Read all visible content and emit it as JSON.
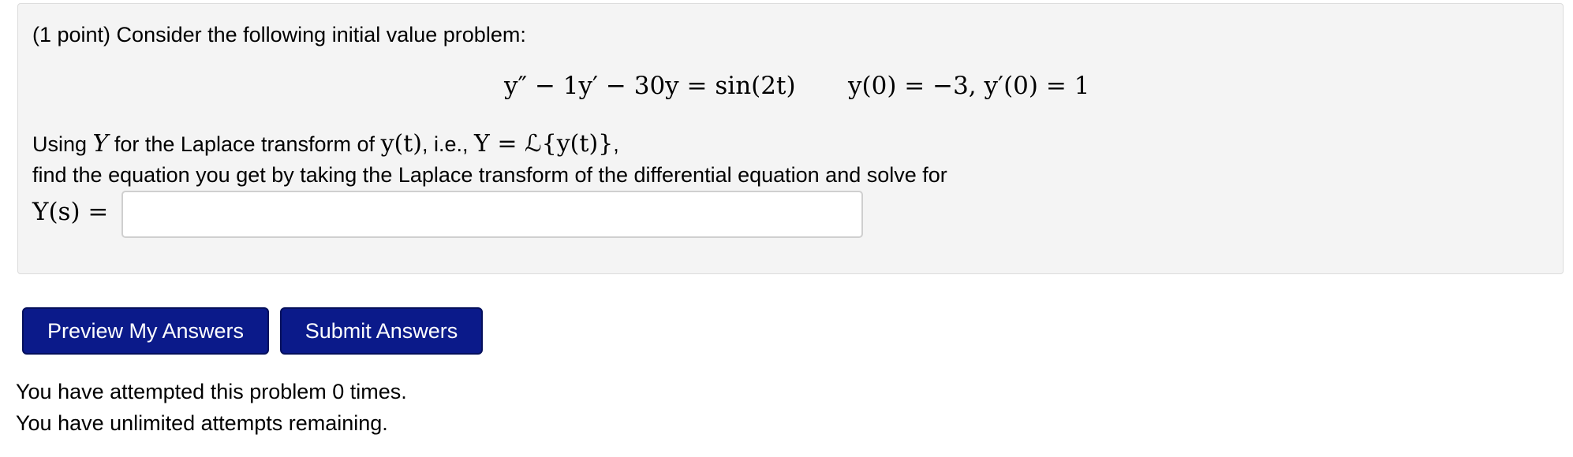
{
  "problem": {
    "intro": "(1 point) Consider the following initial value problem:",
    "ode": "y″ − 1y′ − 30y = sin(2t)",
    "initial_conditions": "y(0) = −3,  y′(0) = 1",
    "laplace_prefix": "Using",
    "laplace_Y": "Y",
    "laplace_middle": "for the Laplace transform of",
    "laplace_yt": "y(t)",
    "laplace_ie": ", i.e.,",
    "laplace_def": "Y = ℒ{y(t)}",
    "laplace_suffix": ",",
    "find_text": "find the equation you get by taking the Laplace transform of the differential equation and solve for",
    "answer_label": "Y(s) =",
    "answer_value": ""
  },
  "buttons": {
    "preview_label": "Preview My Answers",
    "submit_label": "Submit Answers"
  },
  "status": {
    "attempts": "You have attempted this problem 0 times.",
    "remaining": "You have unlimited attempts remaining."
  },
  "colors": {
    "button_bg": "#0b1a8a",
    "panel_bg": "#f4f4f4"
  }
}
